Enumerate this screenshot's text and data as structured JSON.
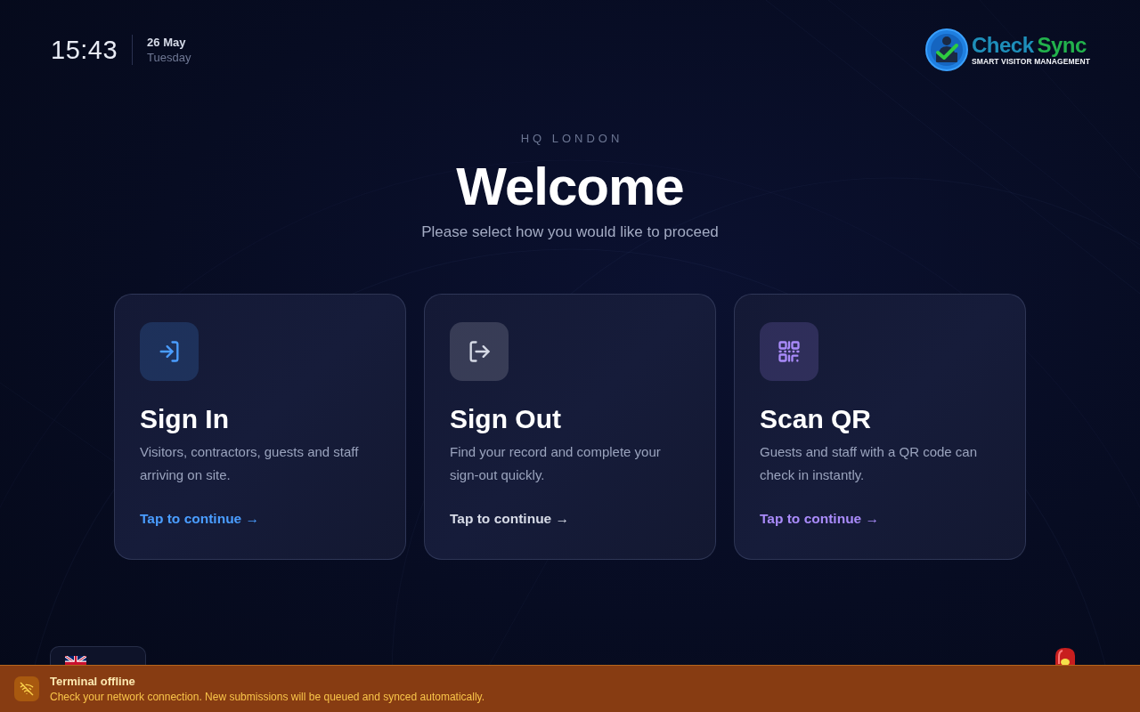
{
  "clock": {
    "time": "15:43",
    "date": "26 May",
    "weekday": "Tuesday"
  },
  "logo": {
    "words": [
      {
        "text": "Check",
        "color": "#1e8fba"
      },
      {
        "text": "Sync",
        "color": "#22b24c"
      }
    ],
    "tagline": "SMART VISITOR MANAGEMENT"
  },
  "header": {
    "location": "HQ LONDON",
    "title": "Welcome",
    "subtitle": "Please select how you would like to proceed"
  },
  "options": [
    {
      "kind": "sign-in",
      "title": "Sign In",
      "description": "Visitors, contractors, guests and staff arriving on site.",
      "action": "Tap to continue →",
      "color": "#4a9dff"
    },
    {
      "kind": "sign-out",
      "title": "Sign Out",
      "description": "Find your record and complete your sign-out quickly.",
      "action": "Tap to continue →",
      "color": "#d6dae6"
    },
    {
      "kind": "scan-qr",
      "title": "Scan QR",
      "description": "Guests and staff with a QR code can check in instantly.",
      "action": "Tap to continue →",
      "color": "#a98bfa"
    }
  ],
  "banner": {
    "title": "Terminal offline",
    "message": "Check your network connection. New submissions will be queued and synced automatically."
  }
}
